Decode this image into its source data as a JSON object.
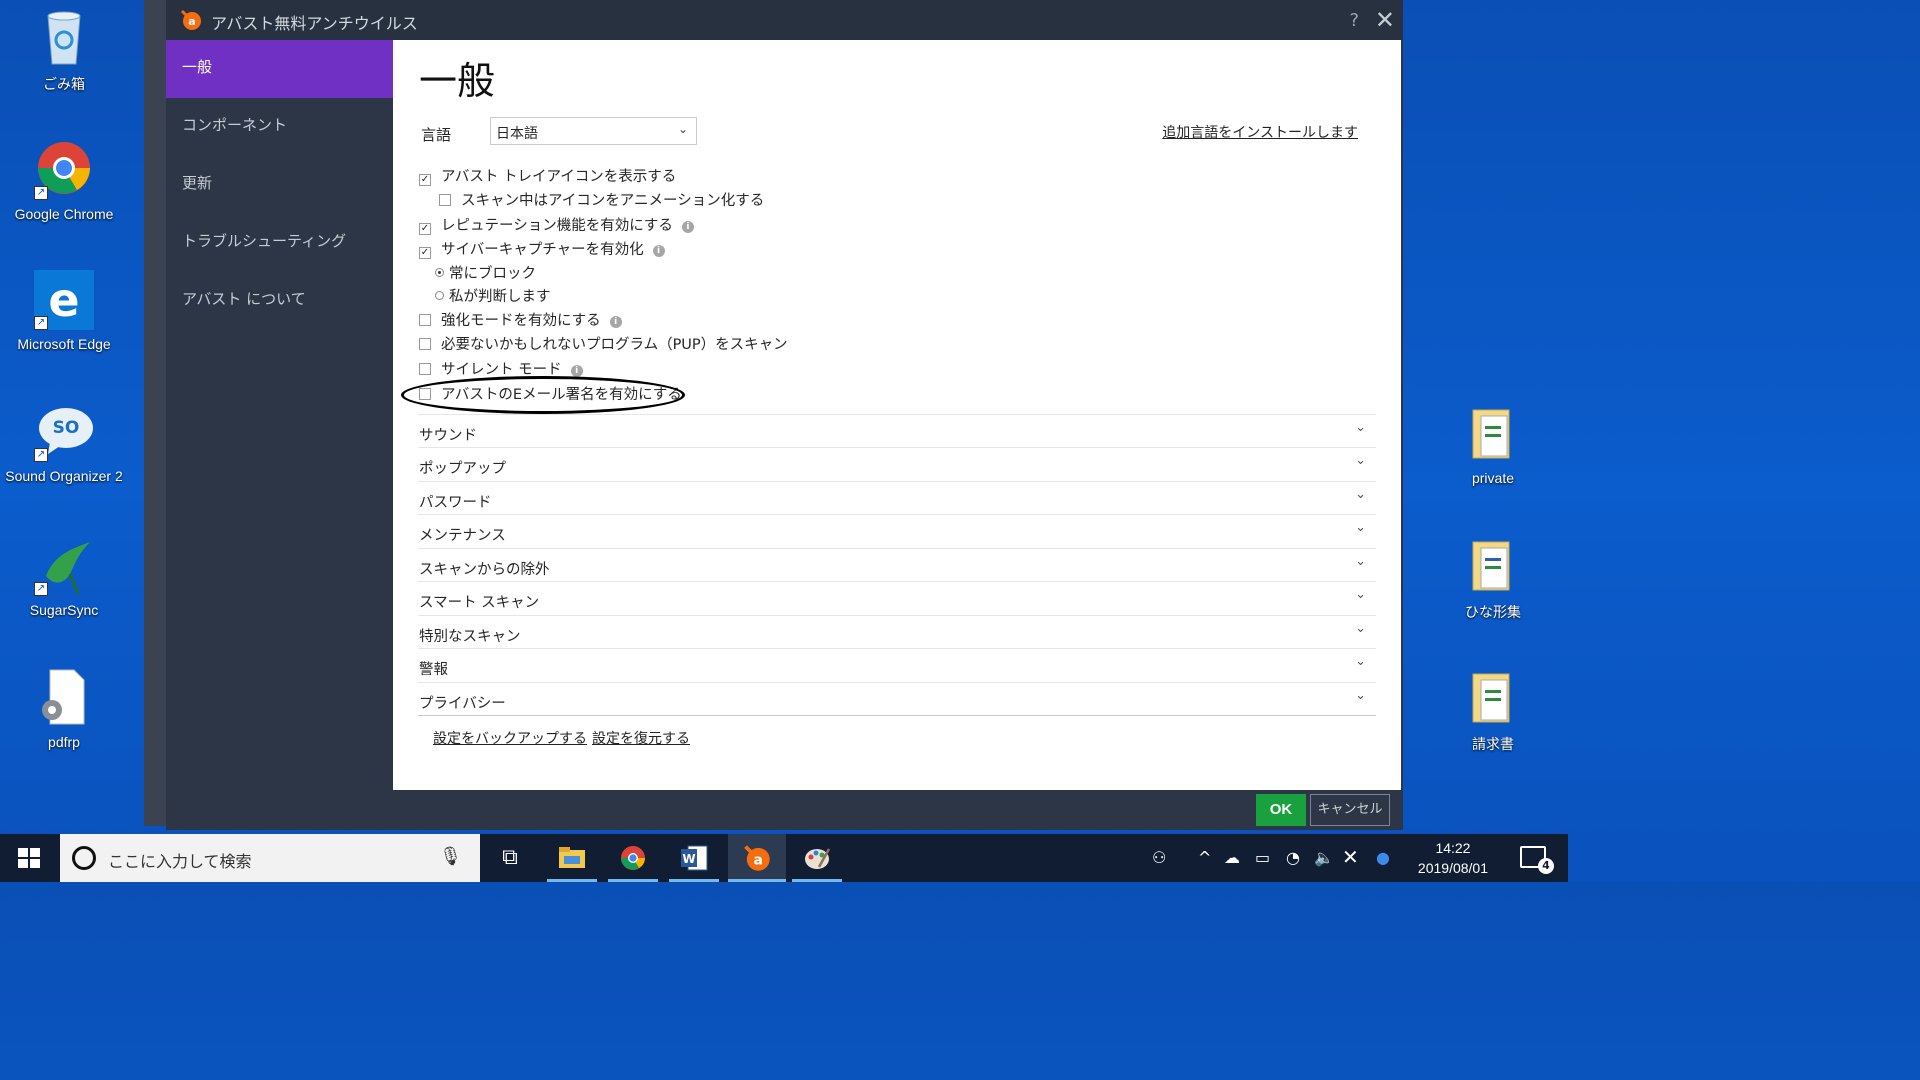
{
  "desktop": {
    "left_icons": [
      {
        "label": "ごみ箱",
        "icon": "recycle-bin-icon"
      },
      {
        "label": "Google Chrome",
        "icon": "chrome-icon"
      },
      {
        "label": "Microsoft Edge",
        "icon": "edge-icon"
      },
      {
        "label": "Sound Organizer 2",
        "icon": "sound-organizer-icon",
        "badge": "SO"
      },
      {
        "label": "SugarSync",
        "icon": "sugarsync-icon"
      },
      {
        "label": "pdfrp",
        "icon": "file-gear-icon"
      }
    ],
    "right_icons": [
      {
        "label": "private",
        "icon": "folder-icon"
      },
      {
        "label": "ひな形集",
        "icon": "folder-icon"
      },
      {
        "label": "請求書",
        "icon": "folder-icon"
      }
    ]
  },
  "dialog": {
    "title": "アバスト無料アンチウイルス",
    "help": "?",
    "close": "✕",
    "sidebar": [
      {
        "label": "一般",
        "active": true
      },
      {
        "label": "コンポーネント"
      },
      {
        "label": "更新"
      },
      {
        "label": "トラブルシューティング"
      },
      {
        "label": "アバスト について"
      }
    ],
    "page_title": "一般",
    "language": {
      "label": "言語",
      "value": "日本語",
      "link": "追加言語をインストールします"
    },
    "options": [
      {
        "label": "アバスト トレイアイコンを表示する",
        "checked": true
      },
      {
        "label": "スキャン中はアイコンをアニメーション化する",
        "checked": false
      },
      {
        "label": "レピュテーション機能を有効にする",
        "checked": true
      },
      {
        "label": "サイバーキャプチャーを有効化",
        "checked": true
      },
      {
        "label": "常にブロック",
        "selected": true
      },
      {
        "label": "私が判断します",
        "selected": false
      },
      {
        "label": "強化モードを有効にする",
        "checked": false
      },
      {
        "label": "必要ないかもしれないプログラム（PUP）をスキャン",
        "checked": false
      },
      {
        "label": "サイレント モード",
        "checked": false
      },
      {
        "label": "アバストのEメール署名を有効にする",
        "checked": false
      }
    ],
    "sections": [
      "サウンド",
      "ポップアップ",
      "パスワード",
      "メンテナンス",
      "スキャンからの除外",
      "スマート スキャン",
      "特別なスキャン",
      "警報",
      "プライバシー"
    ],
    "backup_link": "設定をバックアップする",
    "restore_link": "設定を復元する",
    "ok": "OK",
    "cancel": "キャンセル"
  },
  "taskbar": {
    "search_placeholder": "ここに入力して検索",
    "time": "14:22",
    "date": "2019/08/01",
    "notification_count": "4"
  },
  "colors": {
    "accent": "#7030c4",
    "ok": "#1aa13f",
    "desktop": "#0b5ccc",
    "avast_orange": "#f56d0f"
  }
}
